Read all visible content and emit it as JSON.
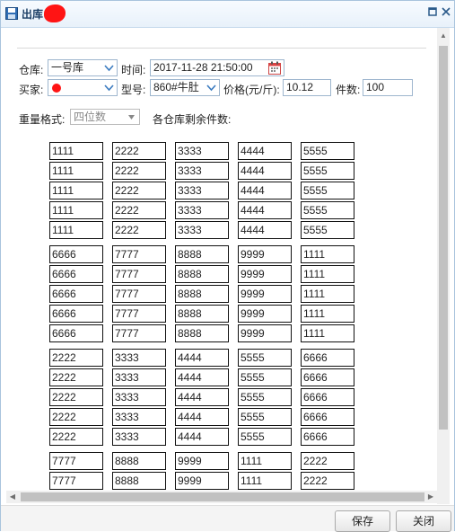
{
  "window": {
    "title": "出库"
  },
  "form": {
    "warehouse_label": "仓库:",
    "warehouse_value": "一号库",
    "time_label": "时间:",
    "time_value": "2017-11-28 21:50:00",
    "buyer_label": "买家:",
    "model_label": "型号:",
    "model_value": "860#牛肚",
    "price_label": "价格(元/斤):",
    "price_value": "10.12",
    "count_label": "件数:",
    "count_value": "100",
    "weight_format_label": "重量格式:",
    "weight_format_value": "四位数",
    "remaining_label": "各仓库剩余件数:"
  },
  "grid": {
    "rows": [
      [
        "1111",
        "2222",
        "3333",
        "4444",
        "5555"
      ],
      [
        "1111",
        "2222",
        "3333",
        "4444",
        "5555"
      ],
      [
        "1111",
        "2222",
        "3333",
        "4444",
        "5555"
      ],
      [
        "1111",
        "2222",
        "3333",
        "4444",
        "5555"
      ],
      [
        "1111",
        "2222",
        "3333",
        "4444",
        "5555"
      ],
      [
        "6666",
        "7777",
        "8888",
        "9999",
        "1111"
      ],
      [
        "6666",
        "7777",
        "8888",
        "9999",
        "1111"
      ],
      [
        "6666",
        "7777",
        "8888",
        "9999",
        "1111"
      ],
      [
        "6666",
        "7777",
        "8888",
        "9999",
        "1111"
      ],
      [
        "6666",
        "7777",
        "8888",
        "9999",
        "1111"
      ],
      [
        "2222",
        "3333",
        "4444",
        "5555",
        "6666"
      ],
      [
        "2222",
        "3333",
        "4444",
        "5555",
        "6666"
      ],
      [
        "2222",
        "3333",
        "4444",
        "5555",
        "6666"
      ],
      [
        "2222",
        "3333",
        "4444",
        "5555",
        "6666"
      ],
      [
        "2222",
        "3333",
        "4444",
        "5555",
        "6666"
      ],
      [
        "7777",
        "8888",
        "9999",
        "1111",
        "2222"
      ],
      [
        "7777",
        "8888",
        "9999",
        "1111",
        "2222"
      ]
    ]
  },
  "footer": {
    "save_label": "保存",
    "close_label": "关闭"
  },
  "icons": {
    "title": "save-disk-icon",
    "maximize": "maximize-icon",
    "close": "close-icon",
    "dropdown": "chevron-down-icon",
    "calendar": "calendar-icon"
  },
  "colors": {
    "title_text": "#1c3f66",
    "border": "#a9c4dd",
    "redaction": "#ff1414"
  }
}
